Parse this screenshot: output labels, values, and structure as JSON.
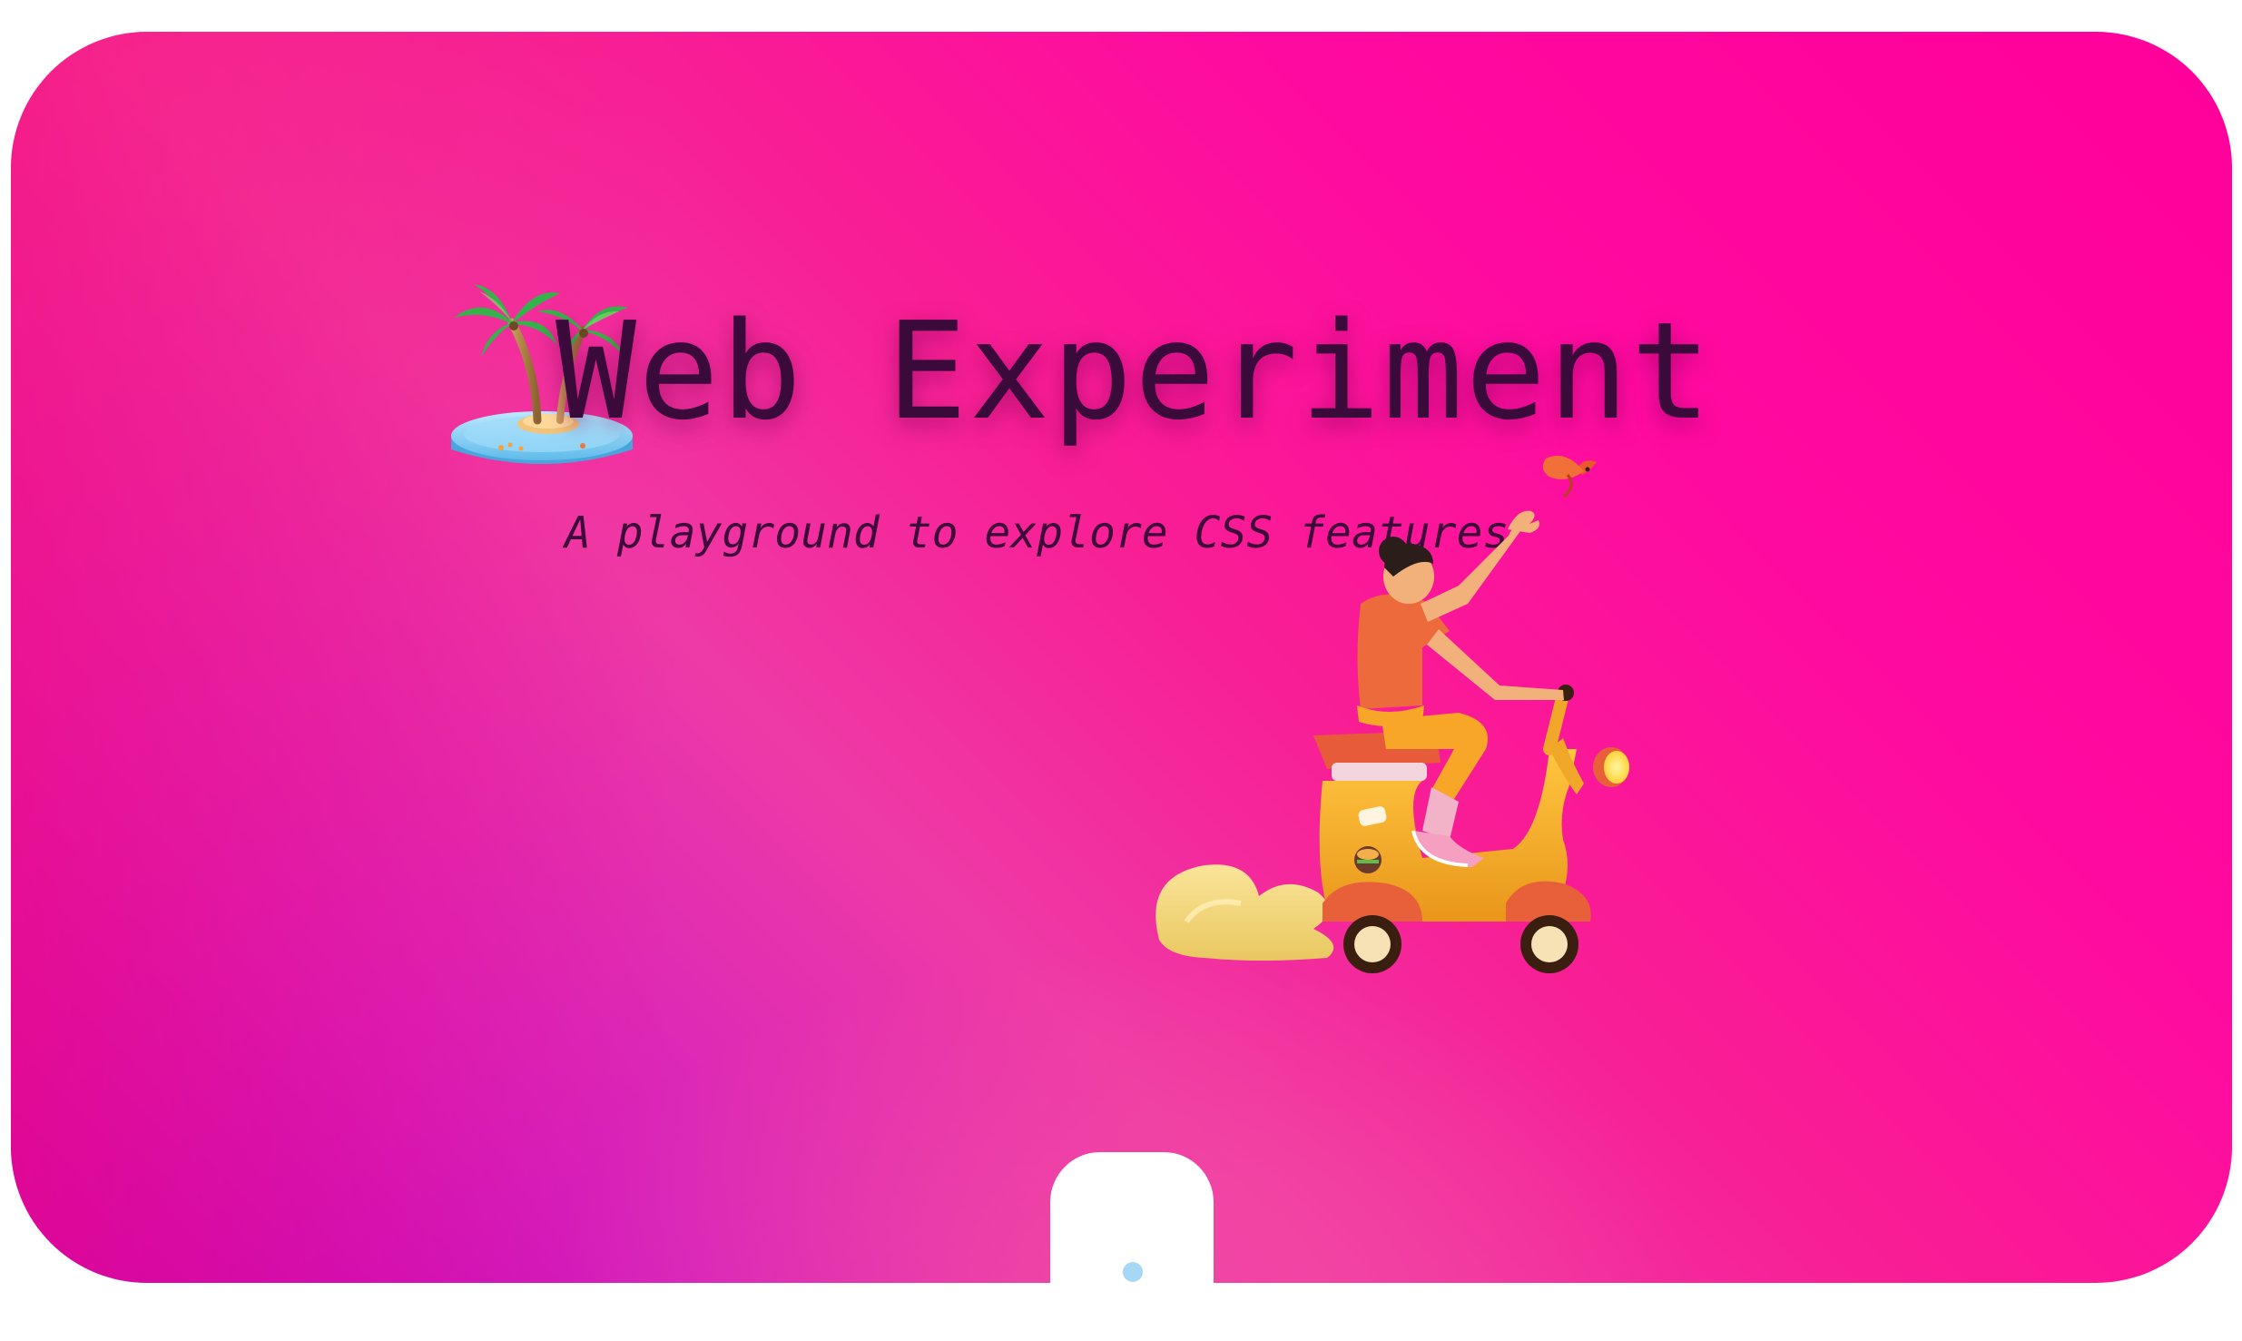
{
  "hero": {
    "title": "Web Experiment",
    "subtitle": "A playground to explore CSS features"
  },
  "illustrations": {
    "island": "palm-tree-island",
    "rider": "person-on-scooter"
  },
  "icons": {
    "bird": "bird-icon",
    "scroll_indicator": "scroll-indicator-dot"
  },
  "colors": {
    "gradient_top_right": "#ff009a",
    "gradient_bottom_left": "#ff1a78",
    "gradient_bottom_right": "#b400c8",
    "title_text": "#3a0a3a",
    "page_background": "#ffffff",
    "indicator_dot": "#a6d8f6"
  }
}
